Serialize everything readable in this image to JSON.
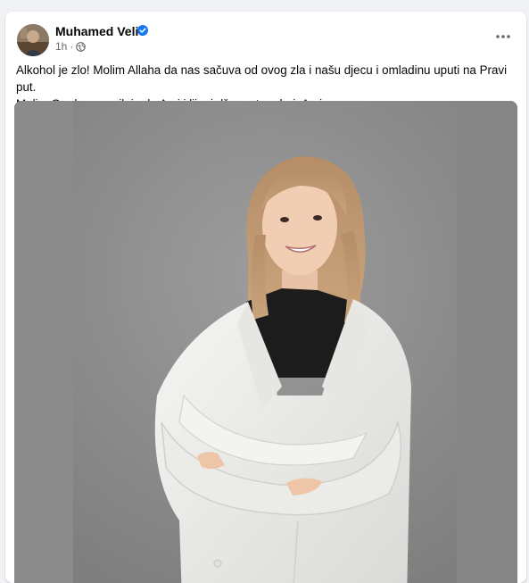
{
  "post": {
    "author": {
      "name": "Muhamed Velic",
      "verified": true,
      "avatar_icon": "profile-photo"
    },
    "timestamp": "1h",
    "audience_icon": "globe-icon",
    "more_icon": "more-options-icon",
    "text": {
      "line1": "Alkohol je zlo! Molim Allaha da nas sačuva od ovog zla i našu djecu i omladinu uputi na Pravi put.",
      "line2": "Molim Ga da se smiluje dr. Azri i lijepi džennet podari. Amin."
    },
    "image": {
      "subject": "woman-in-white-lab-coat",
      "background_color": "#8a8a8a"
    }
  },
  "colors": {
    "page_bg": "#f0f2f5",
    "card_bg": "#ffffff",
    "verified_blue": "#1877f2",
    "meta_gray": "#65676b"
  }
}
